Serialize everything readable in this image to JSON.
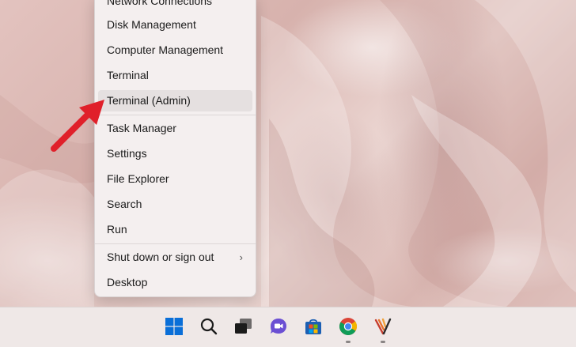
{
  "context_menu": {
    "items": [
      {
        "label": "Network Connections"
      },
      {
        "label": "Disk Management"
      },
      {
        "label": "Computer Management"
      },
      {
        "label": "Terminal"
      },
      {
        "label": "Terminal (Admin)"
      },
      {
        "label": "Task Manager"
      },
      {
        "label": "Settings"
      },
      {
        "label": "File Explorer"
      },
      {
        "label": "Search"
      },
      {
        "label": "Run"
      },
      {
        "label": "Shut down or sign out"
      },
      {
        "label": "Desktop"
      }
    ],
    "highlighted_item": "Terminal (Admin)"
  },
  "taskbar": {
    "icons": [
      {
        "name": "windows-start-icon"
      },
      {
        "name": "search-icon"
      },
      {
        "name": "task-view-icon"
      },
      {
        "name": "teams-chat-icon"
      },
      {
        "name": "microsoft-store-icon"
      },
      {
        "name": "chrome-icon"
      },
      {
        "name": "app-icon"
      }
    ]
  },
  "colors": {
    "accent_arrow": "#e0202a",
    "windows_blue": "#0a6fd8"
  }
}
